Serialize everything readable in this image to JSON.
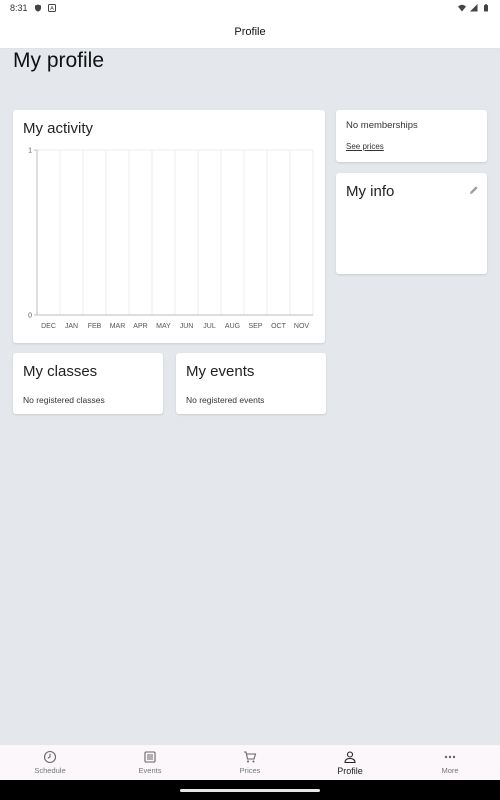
{
  "status_bar": {
    "time": "8:31",
    "icons": [
      "shield-icon",
      "a-icon",
      "wifi-icon",
      "signal-icon",
      "battery-icon"
    ]
  },
  "app_bar": {
    "title": "Profile"
  },
  "page": {
    "title": "My profile"
  },
  "activity": {
    "title": "My activity",
    "chart_data": {
      "type": "bar",
      "title": "My activity",
      "categories": [
        "DEC",
        "JAN",
        "FEB",
        "MAR",
        "APR",
        "MAY",
        "JUN",
        "JUL",
        "AUG",
        "SEP",
        "OCT",
        "NOV"
      ],
      "values": [
        0,
        0,
        0,
        0,
        0,
        0,
        0,
        0,
        0,
        0,
        0,
        0
      ],
      "ylim": [
        0,
        1
      ],
      "yticks": [
        "0",
        "1"
      ],
      "xlabel": "",
      "ylabel": "",
      "grid": true
    }
  },
  "memberships": {
    "text": "No memberships",
    "link": "See prices"
  },
  "my_info": {
    "title": "My info",
    "icon": "edit-icon"
  },
  "classes": {
    "title": "My classes",
    "empty": "No registered classes"
  },
  "events": {
    "title": "My events",
    "empty": "No registered events"
  },
  "bottom_nav": [
    {
      "label": "Schedule",
      "icon": "clock-icon"
    },
    {
      "label": "Events",
      "icon": "list-icon"
    },
    {
      "label": "Prices",
      "icon": "cart-icon"
    },
    {
      "label": "Profile",
      "icon": "person-icon",
      "active": true
    },
    {
      "label": "More",
      "icon": "more-icon"
    }
  ]
}
